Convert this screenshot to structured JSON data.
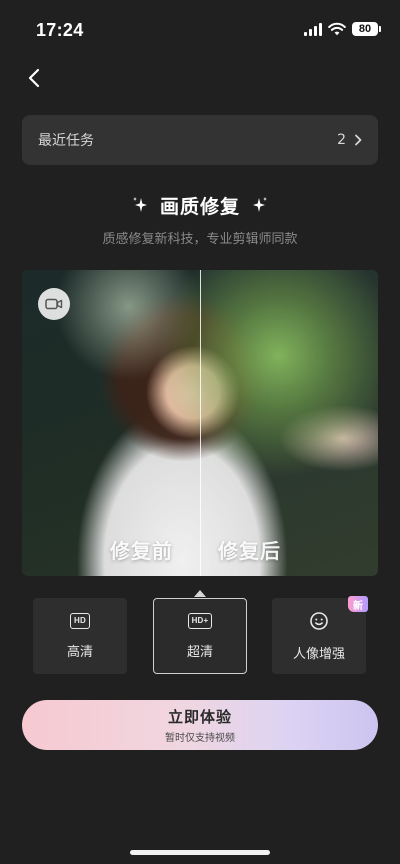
{
  "status_bar": {
    "time": "17:24",
    "battery": "80"
  },
  "recent": {
    "label": "最近任务",
    "count": "2"
  },
  "feature": {
    "title": "画质修复",
    "subtitle": "质感修复新科技，专业剪辑师同款"
  },
  "preview": {
    "before_label": "修复前",
    "after_label": "修复后"
  },
  "options": [
    {
      "icon_text": "HD",
      "label": "高清",
      "icon": "hd-icon",
      "selected": false
    },
    {
      "icon_text": "HD+",
      "label": "超清",
      "icon": "hd-plus-icon",
      "selected": true
    },
    {
      "label": "人像增强",
      "icon": "face-icon",
      "badge": "新",
      "selected": false
    }
  ],
  "cta": {
    "title": "立即体验",
    "subtitle": "暂时仅支持视频"
  },
  "colors": {
    "background": "#202020",
    "card": "#333333",
    "cta_gradient_start": "#f7c9d1",
    "cta_gradient_end": "#cdc4f0",
    "badge_gradient_start": "#ff9ccf",
    "badge_gradient_end": "#b39bff"
  },
  "icons": {
    "back": "chevron-left-icon",
    "recent_arrow": "chevron-right-icon",
    "sparkle": "sparkle-icon",
    "camera": "video-camera-icon"
  }
}
